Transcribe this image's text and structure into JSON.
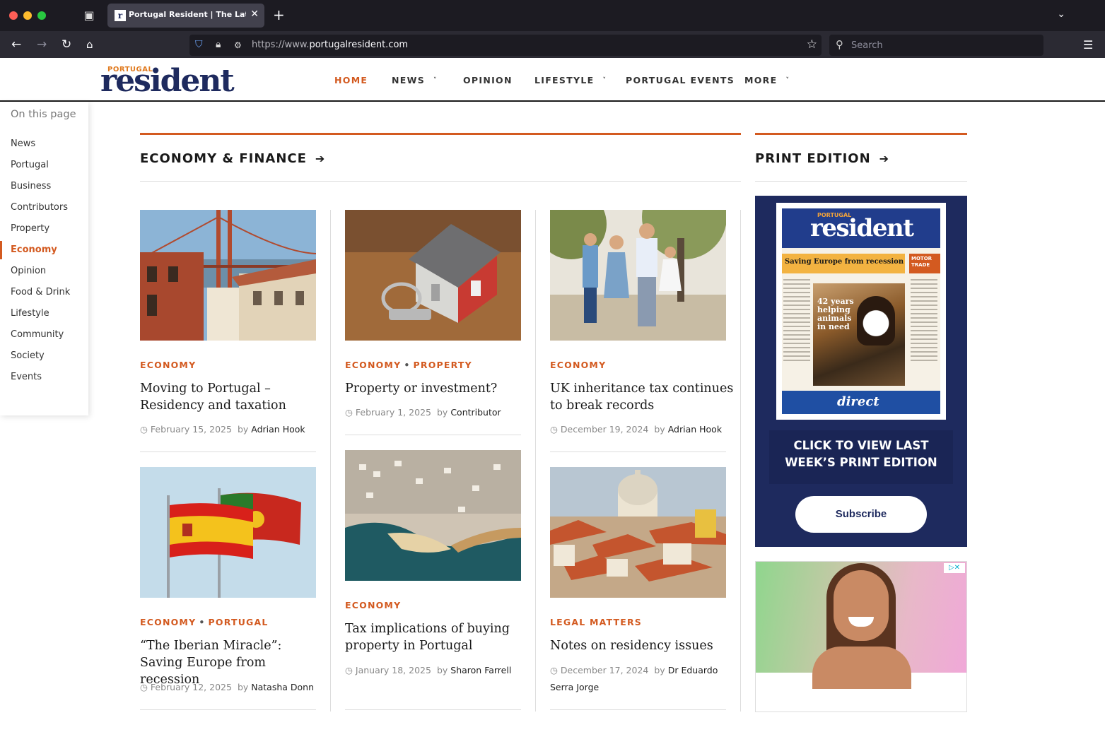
{
  "browser": {
    "tab_title": "Portugal Resident | The Latest News",
    "tab_favicon": "r",
    "url_prefix": "https://www.",
    "url_domain": "portugalresident.com",
    "search_placeholder": "Search"
  },
  "site": {
    "logo_top": "PORTUGAL",
    "logo_main": "resident",
    "nav": [
      {
        "label": "HOME"
      },
      {
        "label": "NEWS"
      },
      {
        "label": "OPINION"
      },
      {
        "label": "LIFESTYLE"
      },
      {
        "label": "PORTUGAL EVENTS"
      },
      {
        "label": "MORE"
      }
    ]
  },
  "toc": {
    "title": "On this page",
    "items": [
      "News",
      "Portugal",
      "Business",
      "Contributors",
      "Property",
      "Economy",
      "Opinion",
      "Food & Drink",
      "Lifestyle",
      "Community",
      "Society",
      "Events"
    ],
    "active": "Economy"
  },
  "section": {
    "title": "ECONOMY & FINANCE",
    "arrow": "➔"
  },
  "print": {
    "title": "PRINT EDITION",
    "arrow": "➔",
    "cover_top": "PORTUGAL",
    "cover_name": "resident",
    "cover_headline": "Saving Europe from recession",
    "cover_motor": "MOTOR TRADE",
    "cover_photo_text": "42 years helping animals in need",
    "cover_ad": "direct",
    "cta": "CLICK TO VIEW LAST WEEK’S PRINT EDITION",
    "subscribe": "Subscribe"
  },
  "articles": [
    {
      "cats": [
        "ECONOMY"
      ],
      "title": "Moving to Portugal – Residency and taxation",
      "date": "February 15, 2025",
      "by": "by",
      "author": "Adrian Hook"
    },
    {
      "cats": [
        "ECONOMY",
        "PROPERTY"
      ],
      "title": "Property or investment?",
      "date": "February 1, 2025",
      "by": "by",
      "author": "Contributor"
    },
    {
      "cats": [
        "ECONOMY"
      ],
      "title": "UK inheritance tax continues to break records",
      "date": "December 19, 2024",
      "by": "by",
      "author": "Adrian Hook"
    },
    {
      "cats": [
        "ECONOMY",
        "PORTUGAL"
      ],
      "title": "“The Iberian Miracle”: Saving Europe from recession",
      "date": "February 12, 2025",
      "by": "by",
      "author": "Natasha Donn"
    },
    {
      "cats": [
        "ECONOMY"
      ],
      "title": "Tax implications of buying property in Portugal",
      "date": "January 18, 2025",
      "by": "by",
      "author": "Sharon Farrell"
    },
    {
      "cats": [
        "LEGAL MATTERS"
      ],
      "title": "Notes on residency issues",
      "date": "December 17, 2024",
      "by": "by",
      "author": "Dr Eduardo Serra Jorge"
    }
  ]
}
